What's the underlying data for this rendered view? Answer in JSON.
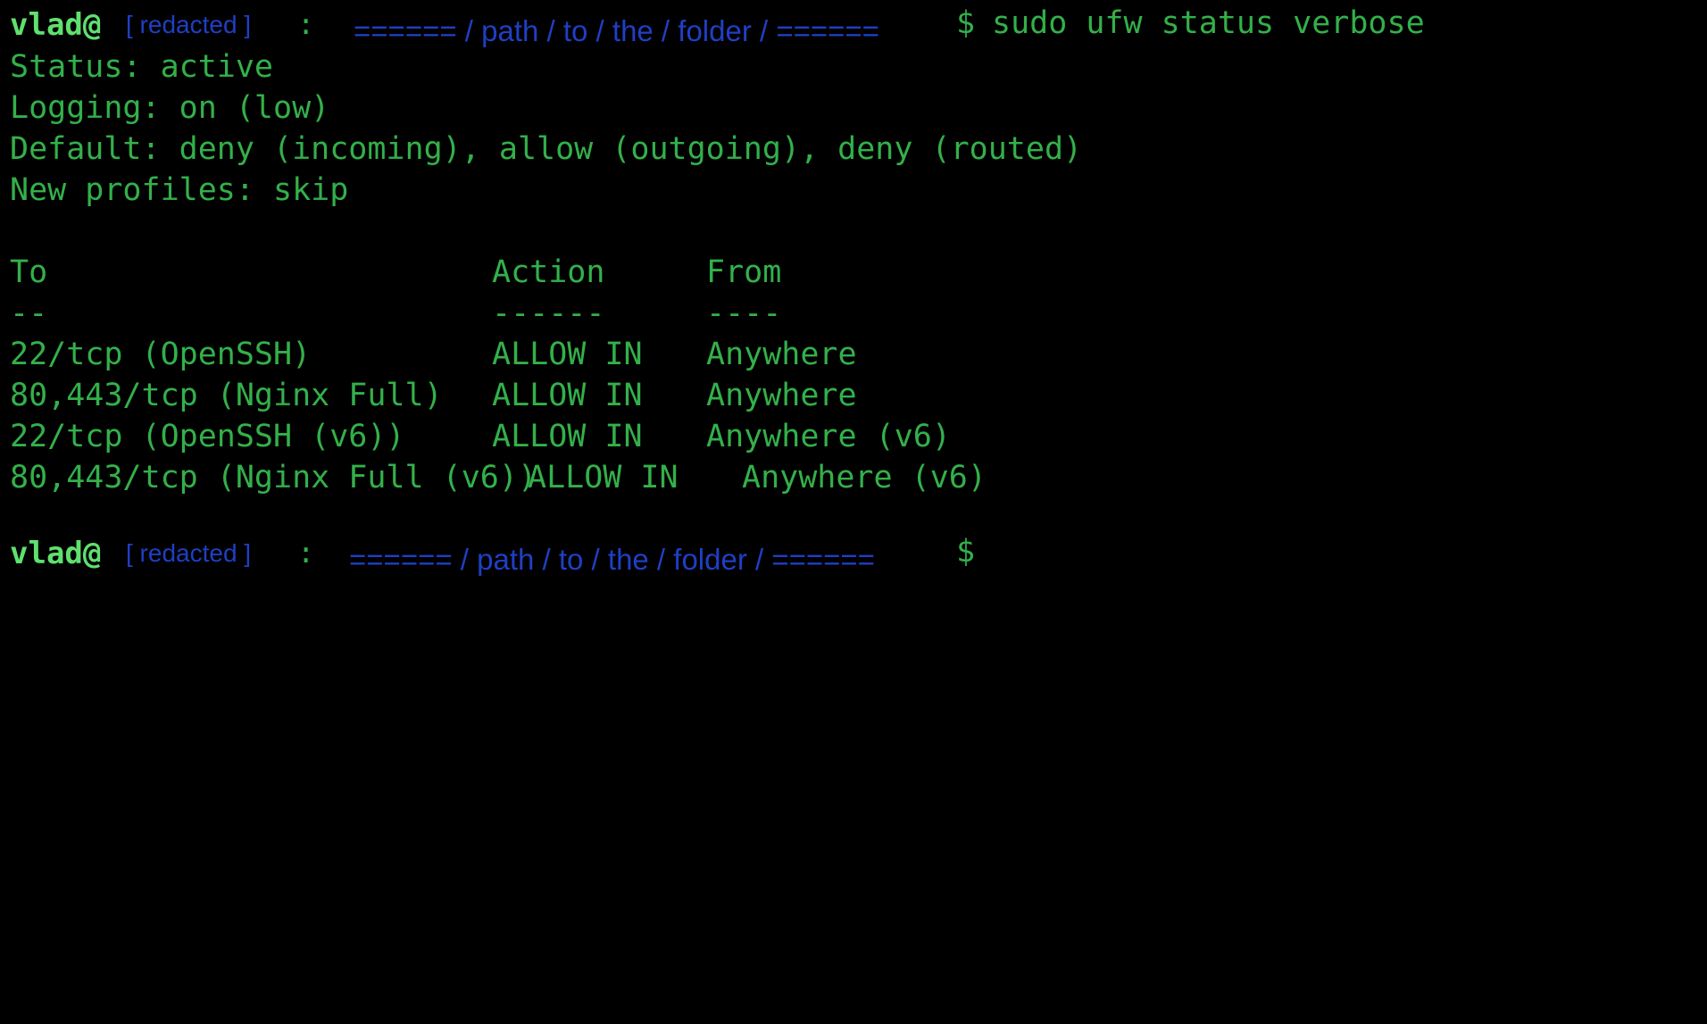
{
  "prompt": {
    "user": "vlad@",
    "host": "[ redacted ]",
    "separator": ":",
    "path": "====== / path / to / the / folder / ======",
    "symbol": "$"
  },
  "command": "sudo ufw status verbose",
  "output": {
    "status": "Status: active",
    "logging": "Logging: on (low)",
    "default": "Default: deny (incoming), allow (outgoing), deny (routed)",
    "new_profiles": "New profiles: skip"
  },
  "rules_table": {
    "headers": {
      "to": "To",
      "action": "Action",
      "from": "From"
    },
    "dividers": {
      "to": "--",
      "action": "------",
      "from": "----"
    },
    "rows": [
      {
        "to": "22/tcp (OpenSSH)",
        "action": "ALLOW IN",
        "from": "Anywhere"
      },
      {
        "to": "80,443/tcp (Nginx Full)",
        "action": "ALLOW IN",
        "from": "Anywhere"
      },
      {
        "to": "22/tcp (OpenSSH (v6))",
        "action": "ALLOW IN",
        "from": "Anywhere (v6)"
      },
      {
        "to": "80,443/tcp (Nginx Full (v6))",
        "action": "ALLOW IN",
        "from": "Anywhere (v6)"
      }
    ]
  },
  "colors": {
    "background": "#000000",
    "text": "#33b04a",
    "user": "#5fe06f",
    "host_path": "#1f3fc4"
  }
}
